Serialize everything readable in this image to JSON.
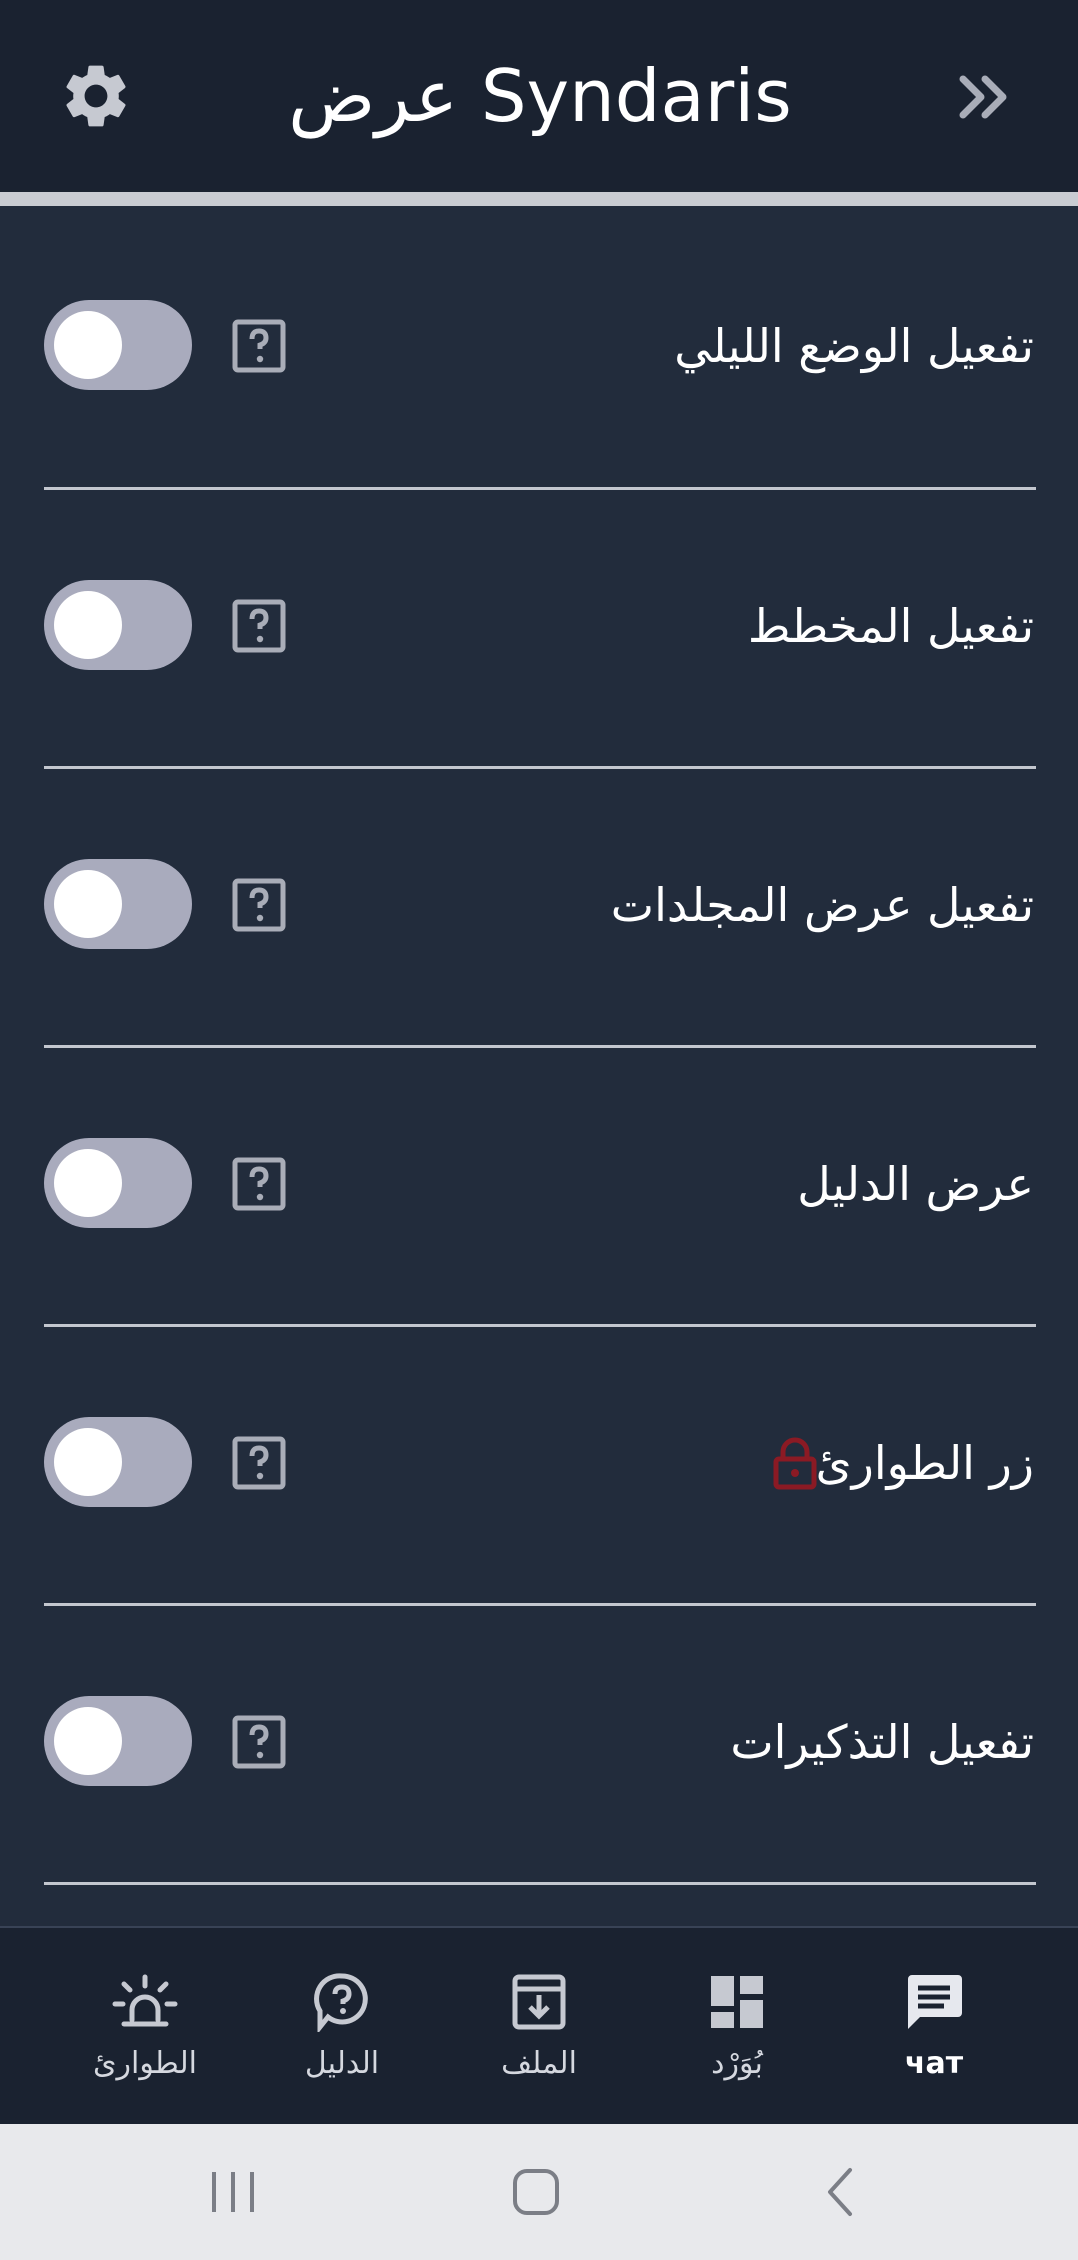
{
  "header": {
    "title": "عرض Syndaris",
    "settings_icon": "gear-icon",
    "collapse_icon": "double-chevron-right-icon"
  },
  "settings": [
    {
      "label": "تفعيل الوضع الليلي",
      "enabled": false,
      "locked": false
    },
    {
      "label": "تفعيل المخطط",
      "enabled": false,
      "locked": false
    },
    {
      "label": "تفعيل عرض المجلدات",
      "enabled": false,
      "locked": false
    },
    {
      "label": "عرض الدليل",
      "enabled": false,
      "locked": false
    },
    {
      "label": "زر الطوارئ",
      "enabled": false,
      "locked": true
    },
    {
      "label": "تفعيل التذكيرات",
      "enabled": false,
      "locked": false
    }
  ],
  "bottom_nav": [
    {
      "label": "الطوارئ",
      "icon": "alarm-siren-icon"
    },
    {
      "label": "الدليل",
      "icon": "help-bubble-icon"
    },
    {
      "label": "الملف",
      "icon": "archive-download-icon"
    },
    {
      "label": "بُوَرْد",
      "icon": "dashboard-icon"
    },
    {
      "label": "чат",
      "icon": "chat-icon",
      "active": true
    }
  ],
  "colors": {
    "background": "#222c3c",
    "header": "#1a2230",
    "toggle_off": "#a9abbd",
    "lock": "#8b1a24"
  }
}
